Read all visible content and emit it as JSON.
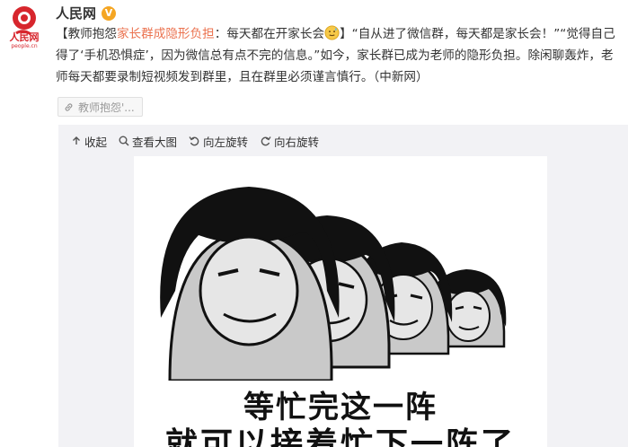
{
  "post": {
    "author_name": "人民网",
    "avatar_brand_text": "人民网",
    "avatar_domain_text": "people.cn",
    "avatar_icon": "people-daily-logo",
    "verified_icon": "verified-badge-icon",
    "verified_color": "#f5a623",
    "text_open_bracket": "【教师抱怨",
    "text_highlight": "家长群成隐形负担",
    "text_after_highlight": "：每天都在开家长会",
    "emoji_icon": "sweat-smile-emoji-icon",
    "text_rest": "】“自从进了微信群，每天都是家长会！”“觉得自己得了‘手机恐惧症’，因为微信总有点不完的信息。”如今，家长群已成为老师的隐形负担。除闲聊轰炸，老师每天都要录制短视频发到群里，且在群里必须谨言慎行。（中新网）",
    "highlight_color": "#eb7350",
    "topic_tag": {
      "icon": "link-icon",
      "label": "教师抱怨'..."
    }
  },
  "media": {
    "toolbar": [
      {
        "icon": "collapse-arrow-icon",
        "label": "收起"
      },
      {
        "icon": "magnifier-icon",
        "label": "查看大图"
      },
      {
        "icon": "rotate-left-icon",
        "label": "向左旋转"
      },
      {
        "icon": "rotate-right-icon",
        "label": "向右旋转"
      }
    ],
    "meme_line_1": "等忙完这一阵",
    "meme_line_2": "就可以接着忙下一阵了"
  }
}
